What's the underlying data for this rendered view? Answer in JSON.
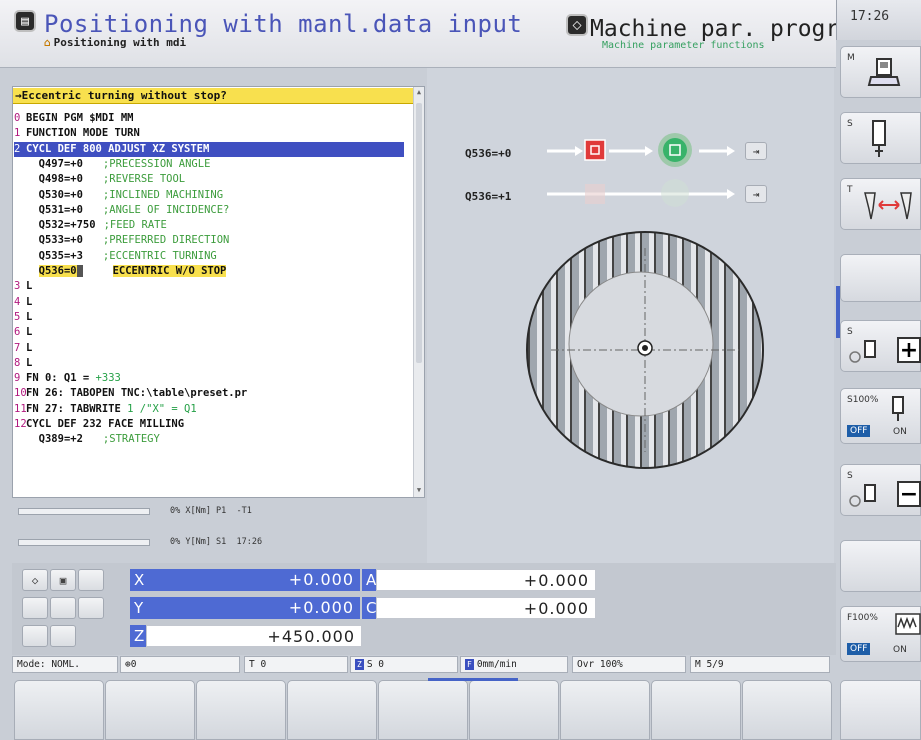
{
  "header": {
    "mode_title": "Positioning with manl.data input",
    "mode_sub": "Positioning with mdi",
    "pgm_title": "Machine par. progr...",
    "pgm_sub": "Machine parameter functions",
    "clock": "17:26"
  },
  "program": {
    "prompt": "→Eccentric turning without stop?",
    "lines": [
      {
        "n": "0",
        "cmd": "BEGIN PGM $MDI MM",
        "param": "",
        "comment": ""
      },
      {
        "n": "1",
        "cmd": "FUNCTION MODE TURN",
        "param": "",
        "comment": ""
      },
      {
        "n": "2",
        "cmd": "CYCL DEF 800 ADJUST XZ SYSTEM",
        "param": "",
        "comment": ""
      },
      {
        "n": "",
        "cmd": "",
        "param": "Q497=+0",
        "comment": ";PRECESSION ANGLE"
      },
      {
        "n": "",
        "cmd": "",
        "param": "Q498=+0",
        "comment": ";REVERSE TOOL"
      },
      {
        "n": "",
        "cmd": "",
        "param": "Q530=+0",
        "comment": ";INCLINED MACHINING"
      },
      {
        "n": "",
        "cmd": "",
        "param": "Q531=+0",
        "comment": ";ANGLE OF INCIDENCE?"
      },
      {
        "n": "",
        "cmd": "",
        "param": "Q532=+750",
        "comment": ";FEED RATE"
      },
      {
        "n": "",
        "cmd": "",
        "param": "Q533=+0",
        "comment": ";PREFERRED DIRECTION"
      },
      {
        "n": "",
        "cmd": "",
        "param": "Q535=+3",
        "comment": ";ECCENTRIC TURNING"
      },
      {
        "n": "",
        "cmd": "",
        "param": "Q536=0",
        "comment": "ECCENTRIC W/O STOP"
      },
      {
        "n": "3",
        "cmd": "L",
        "param": "",
        "comment": ""
      },
      {
        "n": "4",
        "cmd": "L",
        "param": "",
        "comment": ""
      },
      {
        "n": "5",
        "cmd": "L",
        "param": "",
        "comment": ""
      },
      {
        "n": "6",
        "cmd": "L",
        "param": "",
        "comment": ""
      },
      {
        "n": "7",
        "cmd": "L",
        "param": "",
        "comment": ""
      },
      {
        "n": "8",
        "cmd": "L",
        "param": "",
        "comment": ""
      },
      {
        "n": "9",
        "cmd": "FN 0: Q1 =",
        "param": "+333",
        "comment": ""
      },
      {
        "n": "10",
        "cmd": "FN 26: TABOPEN TNC:\\table\\preset.pr",
        "param": "",
        "comment": ""
      },
      {
        "n": "11",
        "cmd": "FN 27: TABWRITE",
        "param": "1 /\"X\" = Q1",
        "comment": ""
      },
      {
        "n": "12",
        "cmd": "CYCL DEF 232 FACE MILLING",
        "param": "",
        "comment": ""
      },
      {
        "n": "",
        "cmd": "",
        "param": "Q389=+2",
        "comment": ";STRATEGY"
      }
    ],
    "status1": "0% X[Nm] P1  -T1",
    "status2": "0% Y[Nm] S1  17:26"
  },
  "graphic": {
    "q536_0": "Q536=+0",
    "q536_1": "Q536=+1"
  },
  "axes": {
    "x_name": "X",
    "x_val": "+0.000",
    "y_name": "Y",
    "y_val": "+0.000",
    "z_name": "Z",
    "z_val": "+450.000",
    "a_name": "A",
    "a_val": "+0.000",
    "c_name": "C",
    "c_val": "+0.000"
  },
  "status_line": {
    "mode": "Mode: NOML.",
    "datum": "0",
    "tool": "T 0",
    "spindle": "S 0",
    "feed": "0mm/min",
    "ovr": "Ovr 100%",
    "m": "M 5/9"
  },
  "right_softkeys": {
    "m": "M",
    "s": "S",
    "t": "T",
    "s_plus": "S",
    "s100": "S100%",
    "s100_off": "OFF",
    "s100_on": "ON",
    "s_minus": "S",
    "f100": "F100%",
    "f100_off": "OFF",
    "f100_on": "ON"
  },
  "colors": {
    "accent_blue": "#4e6ad3",
    "prompt_yellow": "#f8e04e",
    "selection_blue": "#3f4fc1",
    "stop_red": "#e03a3a",
    "go_green": "#38b36a"
  }
}
